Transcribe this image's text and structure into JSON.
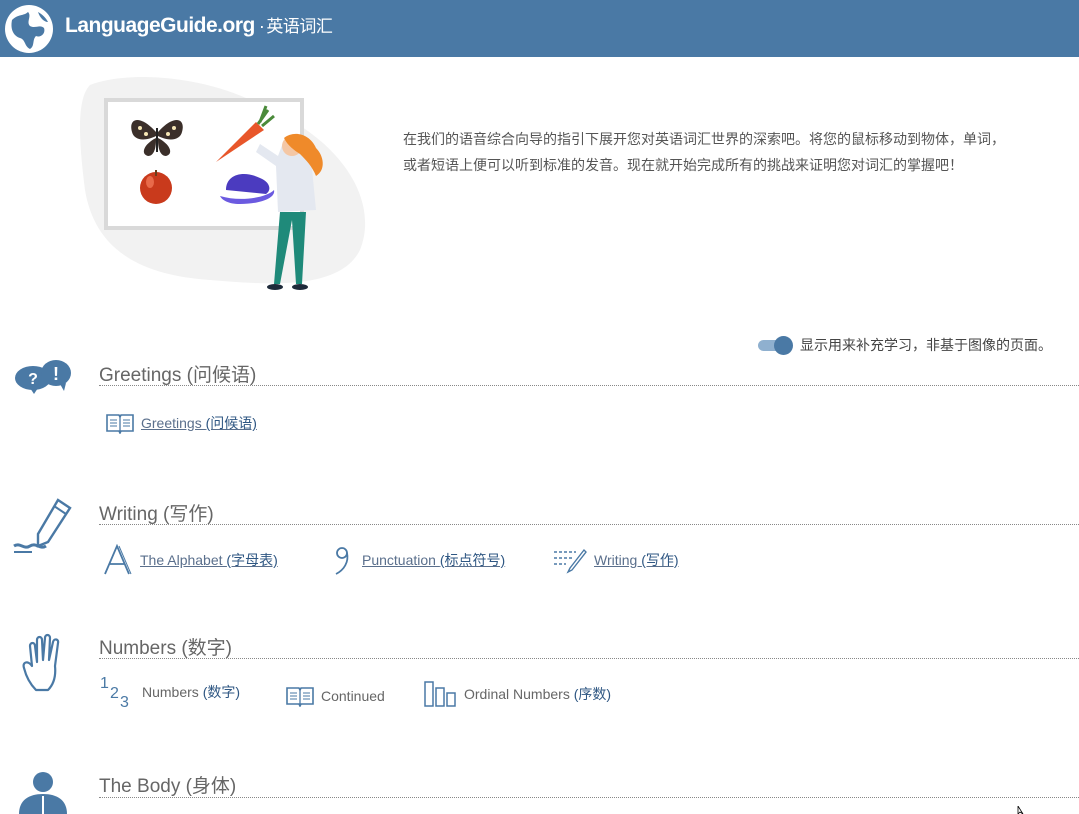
{
  "header": {
    "brand": "LanguageGuide.org",
    "separator": "·",
    "subtitle": "英语词汇"
  },
  "intro": {
    "text": "在我们的语音综合向导的指引下展开您对英语词汇世界的深索吧。将您的鼠标移动到物体，单词，或者短语上便可以听到标准的发音。现在就开始完成所有的挑战来证明您对词汇的掌握吧！"
  },
  "toggle": {
    "label": "显示用来补充学习，非基于图像的页面。",
    "on": true
  },
  "sections": [
    {
      "title": "Greetings (问候语)",
      "icon": "speech-bubbles-icon",
      "links": [
        {
          "en": "Greetings ",
          "zh": "(问候语)",
          "icon": "book-icon"
        }
      ]
    },
    {
      "title": "Writing (写作)",
      "icon": "pen-icon",
      "links": [
        {
          "en": "The Alphabet ",
          "zh": "(字母表)",
          "icon": "letter-a-icon"
        },
        {
          "en": "Punctuation ",
          "zh": "(标点符号)",
          "icon": "comma-icon"
        },
        {
          "en": "Writing ",
          "zh": "(写作)",
          "icon": "writing-lines-icon"
        }
      ]
    },
    {
      "title": "Numbers (数字)",
      "icon": "hand-icon",
      "links": [
        {
          "en": "Numbers ",
          "zh": "(数字)",
          "icon": "numbers-icon"
        },
        {
          "en": "Continued",
          "zh": "",
          "icon": "book-icon"
        },
        {
          "en": "Ordinal Numbers ",
          "zh": "(序数)",
          "icon": "bars-icon"
        }
      ]
    },
    {
      "title": "The Body (身体)",
      "icon": "person-icon",
      "links": []
    }
  ],
  "colors": {
    "header": "#4a79a5",
    "accent": "#4a79a5",
    "link": "#5a6f8c"
  }
}
